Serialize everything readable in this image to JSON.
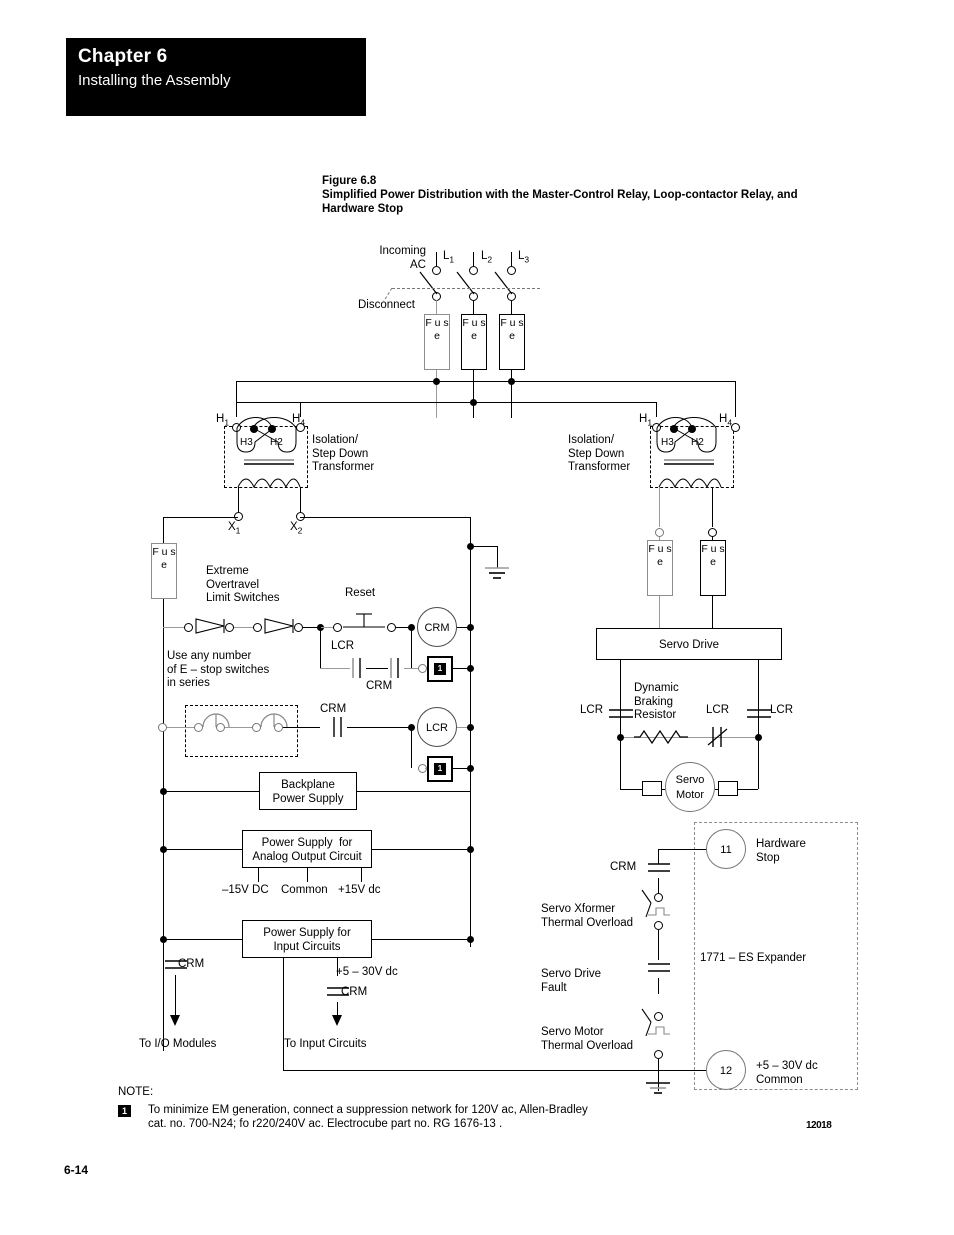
{
  "header": {
    "chapter": "Chapter 6",
    "subtitle": "Installing the Assembly"
  },
  "figure": {
    "number": "Figure 6.8",
    "title_line1": "Simplified Power Distribution with the Master-Control Relay, Loop-contactor Relay, and",
    "title_line2": "Hardware Stop",
    "drawing_id": "12018"
  },
  "footer": {
    "page_number": "6-14"
  },
  "note": {
    "label": "NOTE:",
    "marker": "1",
    "line1": "To minimize EM generation, connect a suppression network for 120V ac, Allen-Bradley",
    "line2": "cat. no. 700-N24; fo r220/240V ac.  Electrocube part no. RG 1676-13 ."
  },
  "diagram": {
    "incoming_ac": "Incoming\nAC",
    "disconnect": "Disconnect",
    "lines": [
      {
        "name": "L",
        "sub": "1"
      },
      {
        "name": "L",
        "sub": "2"
      },
      {
        "name": "L",
        "sub": "3"
      }
    ],
    "fuse_label": "F\nu\ns\ne",
    "transformer_left": {
      "label": "Isolation/\nStep Down\nTransformer",
      "h1": "H",
      "h1_sub": "1",
      "h4": "H",
      "h4_sub": "4",
      "h3": "H3",
      "h2": "H2",
      "x1": "X",
      "x1_sub": "1",
      "x2": "X",
      "x2_sub": "2"
    },
    "transformer_right": {
      "label": "Isolation/\nStep Down\nTransformer",
      "h1": "H",
      "h1_sub": "1",
      "h4": "H",
      "h4_sub": "4",
      "h3": "H3",
      "h2": "H2"
    },
    "control": {
      "limit_switches": "Extreme\nOvertravel\nLimit Switches",
      "estop_note": "Use any number\nof E – stop switches\nin series",
      "reset": "Reset",
      "lcr_contact": "LCR",
      "crm_contact_seal": "CRM",
      "crm_contact_lcr": "CRM",
      "crm_coil": "CRM",
      "lcr_coil": "LCR",
      "suppressor_marker": "1"
    },
    "supplies": {
      "backplane": "Backplane\nPower Supply",
      "analog": "Power Supply  for\nAnalog Output Circuit",
      "analog_rails": [
        "–15V DC",
        "Common",
        "+15V dc"
      ],
      "input": "Power Supply for\nInput Circuits",
      "input_rail": "+5 – 30V dc",
      "crm_left": "CRM",
      "crm_right": "CRM",
      "to_io": "To I/O Modules",
      "to_input": "To Input Circuits"
    },
    "servo": {
      "drive": "Servo Drive",
      "motor": "Servo\nMotor",
      "dynamic_braking": "Dynamic\nBraking\nResistor",
      "lcr_left": "LCR",
      "lcr_mid": "LCR",
      "lcr_right": "LCR"
    },
    "hardware_stop": {
      "terminal_11": "11",
      "terminal_12": "12",
      "title": "Hardware\nStop",
      "expander": "1771 – ES Expander",
      "crm": "CRM",
      "common": "+5 – 30V dc\nCommon",
      "faults": [
        "Servo Xformer\nThermal Overload",
        "Servo Drive\nFault",
        "Servo Motor\nThermal Overload"
      ]
    }
  }
}
